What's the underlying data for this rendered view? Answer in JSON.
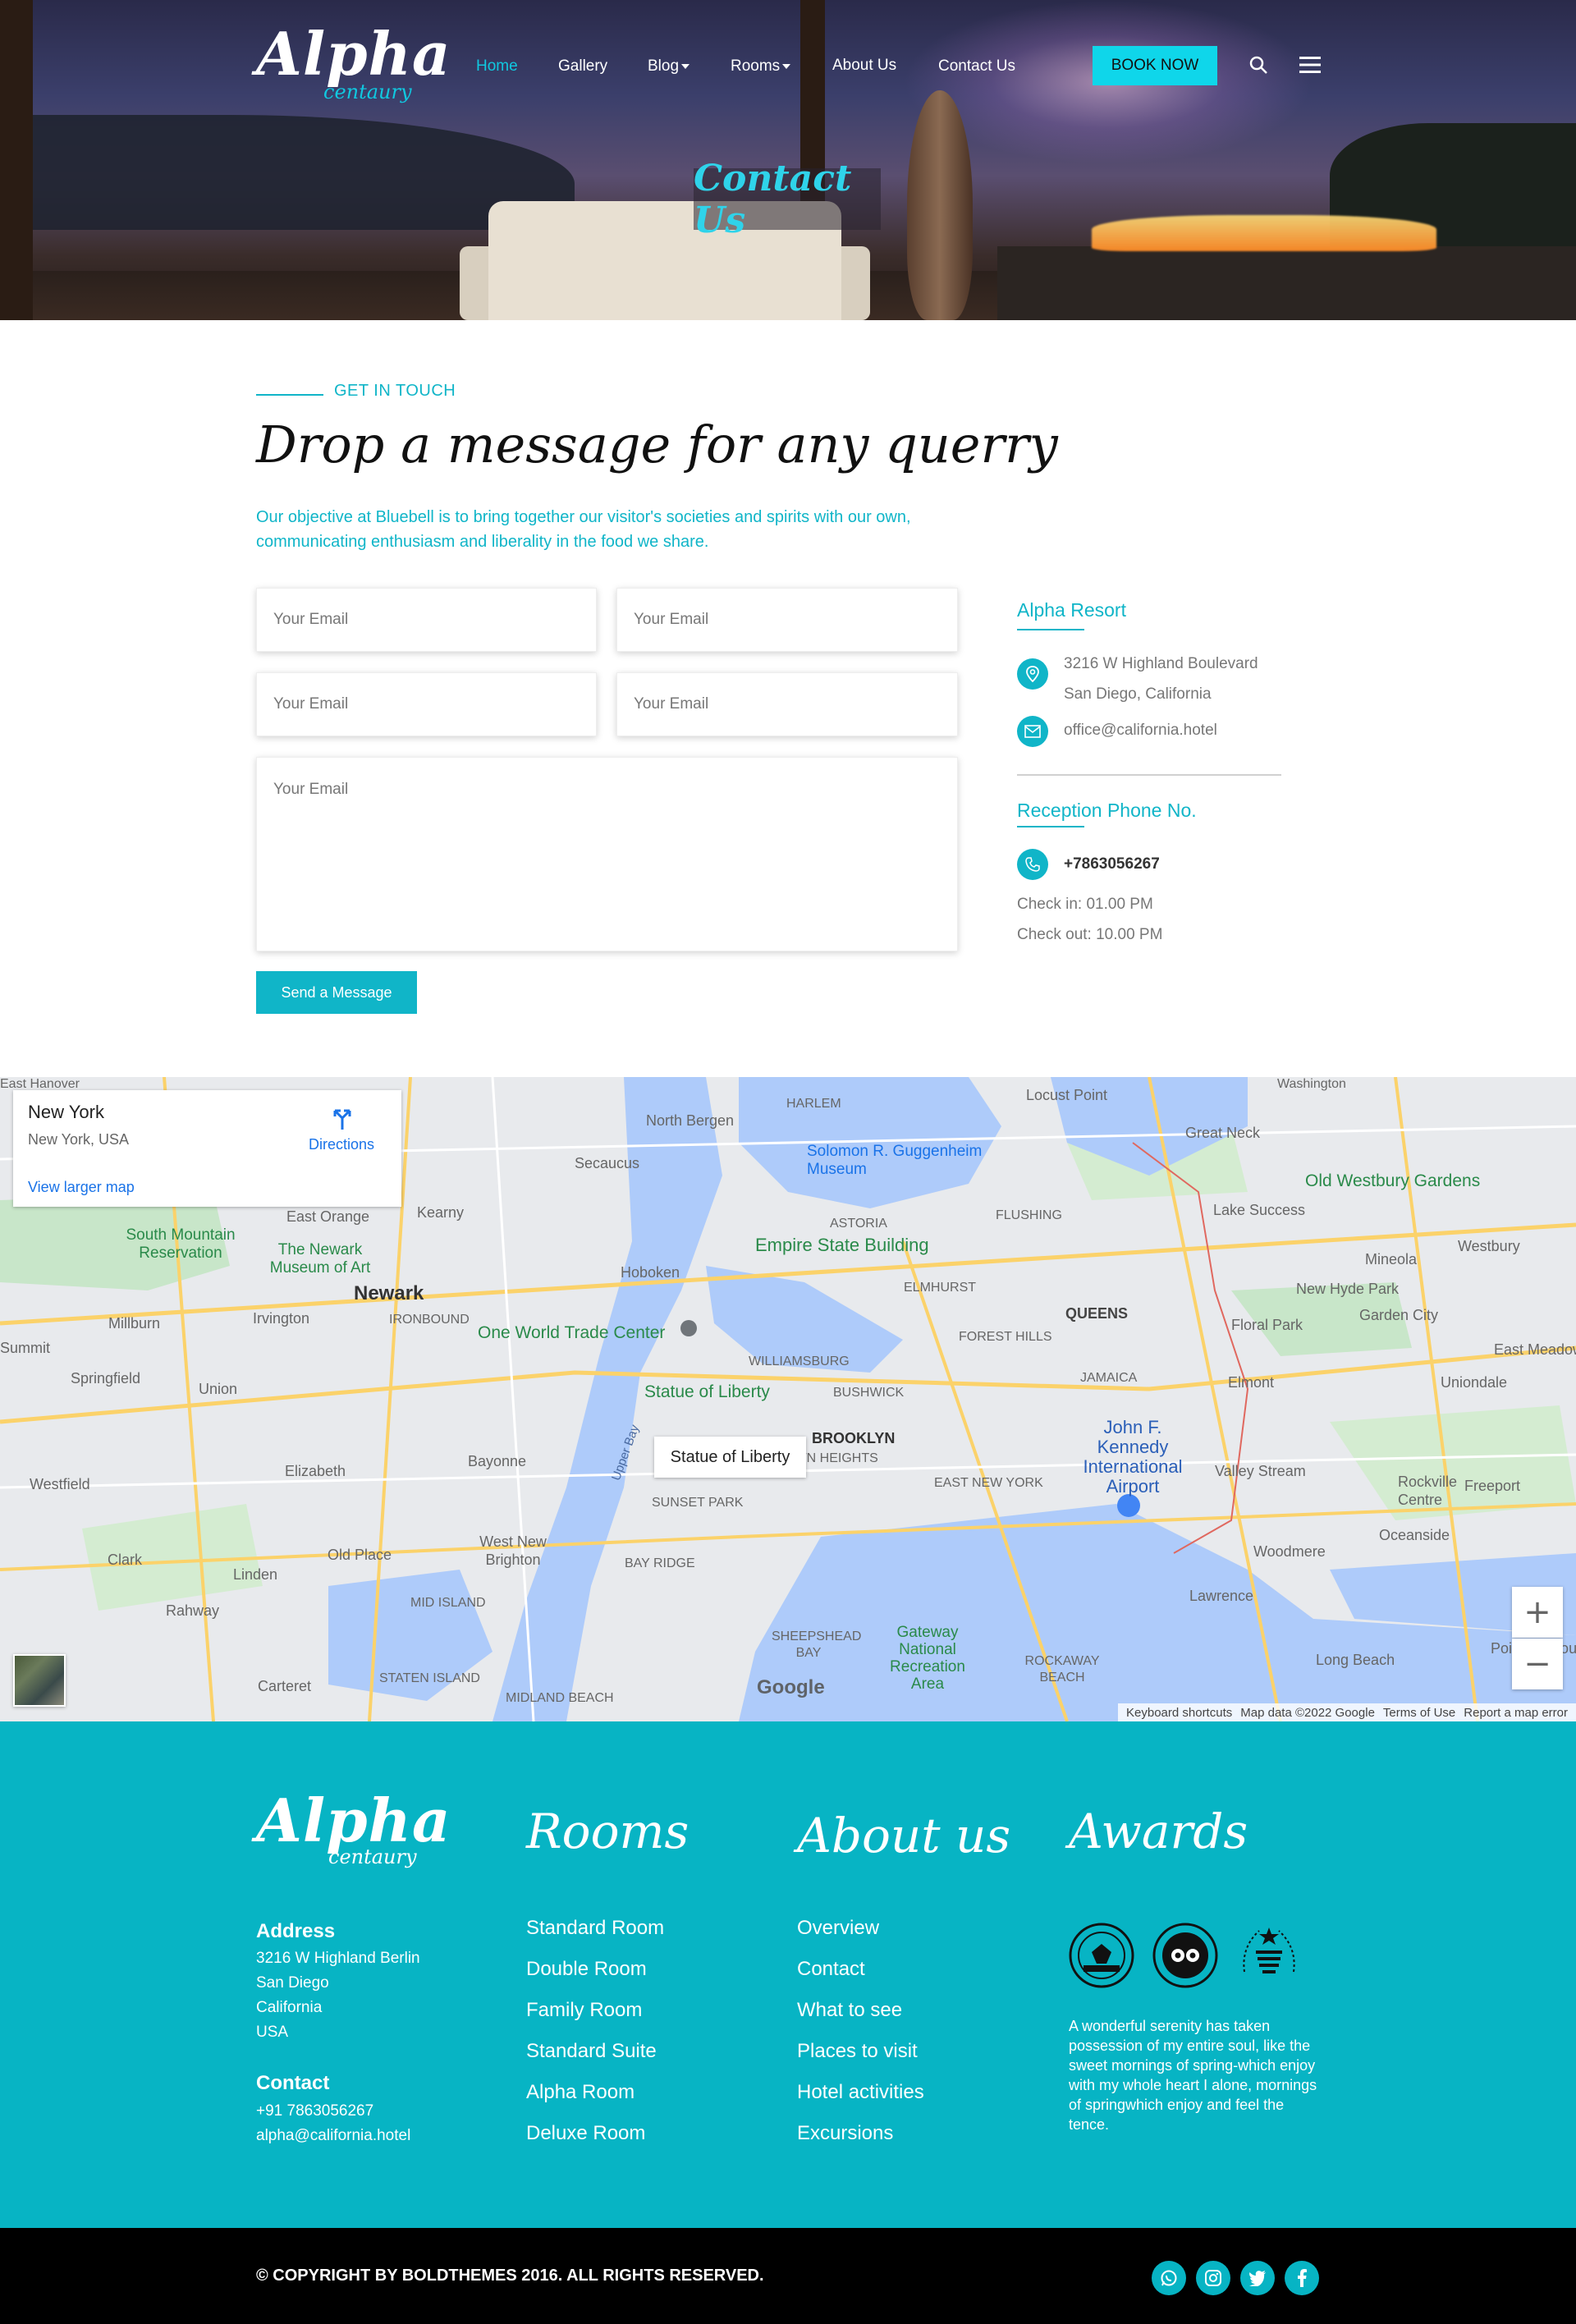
{
  "brand": {
    "name": "Alpha",
    "tagline": "centaury"
  },
  "nav": {
    "items": [
      {
        "label": "Home",
        "active": true,
        "dropdown": false
      },
      {
        "label": "Gallery",
        "active": false,
        "dropdown": false
      },
      {
        "label": "Blog",
        "active": false,
        "dropdown": true
      },
      {
        "label": "Rooms",
        "active": false,
        "dropdown": true
      },
      {
        "label": "About Us",
        "active": false,
        "dropdown": false
      },
      {
        "label": "Contact Us",
        "active": false,
        "dropdown": false
      }
    ],
    "book_label": "BOOK NOW"
  },
  "hero": {
    "title": "Contact Us"
  },
  "contact": {
    "kicker": "GET IN TOUCH",
    "heading": "Drop a message for any querry",
    "intro": "Our objective at Bluebell is to bring together our visitor's societies and spirits with our own, communicating enthusiasm and liberality in the food we share.",
    "fields": {
      "f1": "Your Email",
      "f2": "Your Email",
      "f3": "Your Email",
      "f4": "Your Email",
      "message": "Your Email"
    },
    "send_label": "Send a Message"
  },
  "sidebar": {
    "resort_title": "Alpha Resort",
    "address_line1": "3216 W Highland Boulevard",
    "address_line2": "San Diego, California",
    "email": "office@california.hotel",
    "phone_title": "Reception Phone No.",
    "phone": "+7863056267",
    "checkin": "Check in: 01.00 PM",
    "checkout": "Check out: 10.00 PM"
  },
  "map": {
    "card": {
      "place": "New York",
      "address": "New York, USA",
      "larger": "View larger map",
      "directions": "Directions"
    },
    "statue_box": "Statue of Liberty",
    "labels": {
      "hanover": "East Hanover",
      "north_bergen": "North Bergen",
      "harlem": "HARLEM",
      "secaucus": "Secaucus",
      "solomon": "Solomon R. Guggenheim Museum",
      "locust": "Locust Point",
      "washington": "Washington",
      "great_neck": "Great Neck",
      "old_westbury": "Old Westbury Gardens",
      "orange": "East Orange",
      "kearny": "Kearny",
      "astoria": "ASTORIA",
      "flushing": "FLUSHING",
      "lake_success": "Lake Success",
      "mountain": "South Mountain Reservation",
      "newark_museum": "The Newark Museum of Art",
      "esb": "Empire State Building",
      "hoboken": "Hoboken",
      "elmhurst": "ELMHURST",
      "mineola": "Mineola",
      "westbury": "Westbury",
      "newark": "Newark",
      "ironbound": "IRONBOUND",
      "queens": "QUEENS",
      "new_hyde": "New Hyde Park",
      "garden_city": "Garden City",
      "millburn": "Millburn",
      "irvington": "Irvington",
      "owtc": "One World Trade Center",
      "forest_hills": "FOREST HILLS",
      "floral": "Floral Park",
      "summit": "Summit",
      "springfield": "Springfield",
      "union": "Union",
      "williamsburg": "WILLIAMSBURG",
      "jamaica": "JAMAICA",
      "elmont": "Elmont",
      "uniondale": "Uniondale",
      "east_meadow": "East Meadow",
      "statue": "Statue of Liberty",
      "bushwick": "BUSHWICK",
      "brooklyn": "BROOKLYN",
      "jfk": "John F. Kennedy International Airport",
      "westfield": "Westfield",
      "elizabeth": "Elizabeth",
      "bayonne": "Bayonne",
      "upper_bay": "Upper Bay",
      "crown": "CROWN HEIGHTS",
      "valley_stream": "Valley Stream",
      "rockville": "Rockville Centre",
      "freeport": "Freeport",
      "sunset": "SUNSET PARK",
      "east_ny": "EAST NEW YORK",
      "oceanside": "Oceanside",
      "clark": "Clark",
      "old_place": "Old Place",
      "west_brighton": "West New Brighton",
      "bay_ridge": "BAY RIDGE",
      "woodmere": "Woodmere",
      "linden": "Linden",
      "mid_island": "MID ISLAND",
      "rahway": "Rahway",
      "lawrence": "Lawrence",
      "sheepshead": "SHEEPSHEAD BAY",
      "gateway": "Gateway National Recreation Area",
      "long_beach": "Long Beach",
      "point_lookout": "Point Lookout",
      "carteret": "Carteret",
      "staten": "STATEN ISLAND",
      "midland": "MIDLAND BEACH",
      "rockaway": "ROCKAWAY BEACH"
    },
    "footer_links": [
      "Keyboard shortcuts",
      "Map data ©2022 Google",
      "Terms of Use",
      "Report a map error"
    ],
    "google": "Google"
  },
  "footer": {
    "address_title": "Address",
    "address_lines": [
      "3216 W Highland Berlin",
      "San Diego",
      "California",
      "USA"
    ],
    "contact_title": "Contact",
    "contact_phone": "+91 7863056267",
    "contact_email": "alpha@california.hotel",
    "rooms_title": "Rooms",
    "rooms": [
      "Standard Room",
      "Double Room",
      "Family Room",
      "Standard Suite",
      "Alpha Room",
      "Deluxe Room"
    ],
    "about_title": "About us",
    "about_links": [
      "Overview",
      "Contact",
      "What to see",
      "Places to visit",
      "Hotel activities",
      "Excursions"
    ],
    "awards_title": "Awards",
    "awards_text": "A wonderful serenity has taken possession of my entire soul, like the sweet mornings of spring-which enjoy with my whole heart I alone, mornings of springwhich enjoy and feel the tence.",
    "award_badges": [
      "PLATINUM AWARD",
      "tripadvisor",
      "Hotel Excellence Awards 2010"
    ]
  },
  "bottom": {
    "copyright": "COPYRIGHT BY BOLDTHEMES 2016. ALL RIGHTS RESERVED.",
    "social": [
      "whatsapp-icon",
      "instagram-icon",
      "twitter-icon",
      "facebook-icon"
    ]
  },
  "colors": {
    "accent": "#10b5c8",
    "footer_bg": "#07b4c4",
    "book_btn": "#0fd6ea",
    "bottom_bg": "#000000"
  }
}
